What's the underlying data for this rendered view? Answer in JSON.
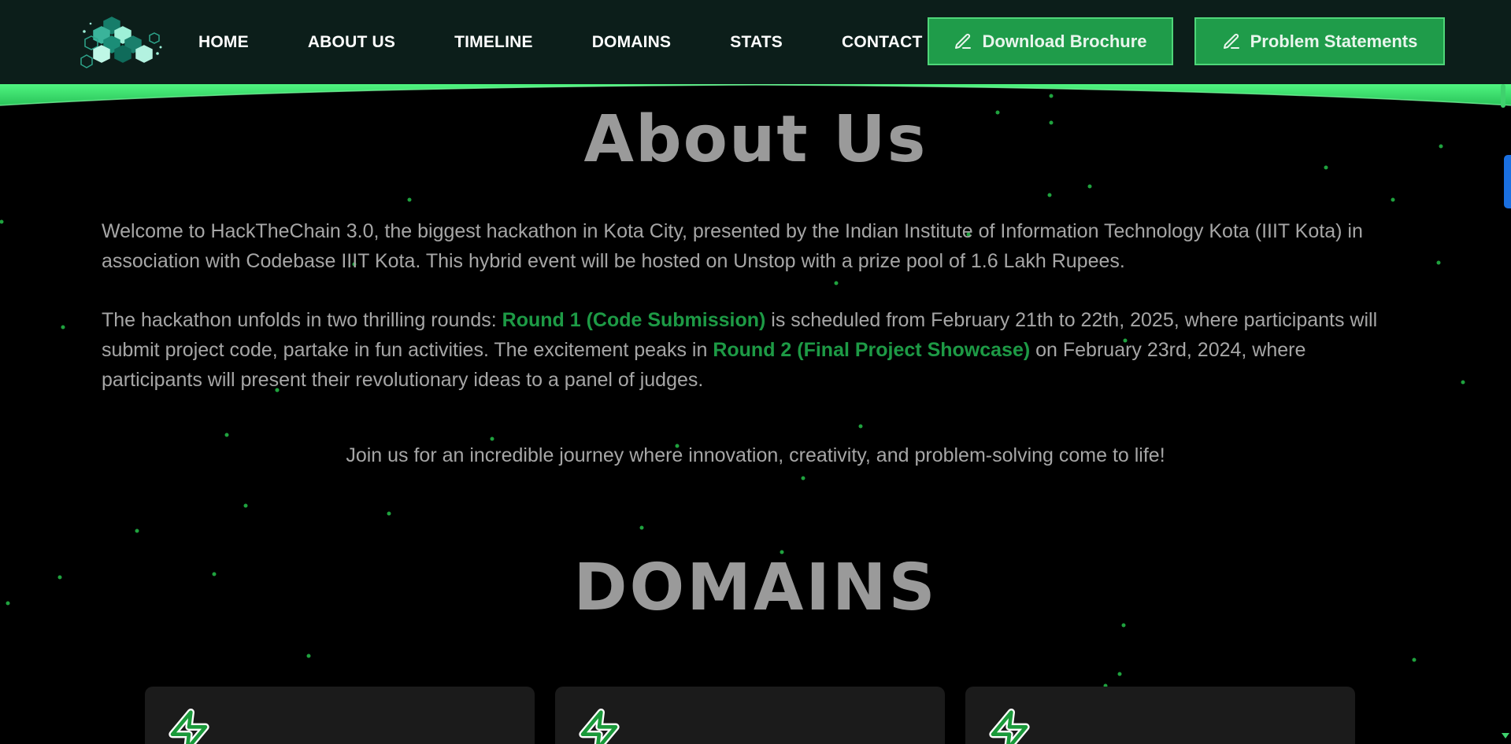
{
  "navbar": {
    "links": [
      "HOME",
      "ABOUT US",
      "TIMELINE",
      "DOMAINS",
      "STATS",
      "CONTACT"
    ],
    "brochure_label": "Download Brochure",
    "problems_label": "Problem Statements"
  },
  "about": {
    "title": "About Us",
    "para1": "Welcome to HackTheChain 3.0, the biggest hackathon in Kota City, presented by the Indian Institute of Information Technology Kota (IIIT Kota) in association with Codebase IIIT Kota. This hybrid event will be hosted on Unstop with a prize pool of 1.6 Lakh Rupees.",
    "para2_a": "The hackathon unfolds in two thrilling rounds: ",
    "round1": "Round 1 (Code Submission)",
    "para2_b": " is scheduled from February 21th to 22th, 2025, where participants will submit project code, partake in fun activities. The excitement peaks in ",
    "round2": "Round 2 (Final Project Showcase)",
    "para2_c": " on February 23rd, 2024, where participants will present their revolutionary ideas to a panel of judges.",
    "para3": "Join us for an incredible journey where innovation, creativity, and problem-solving come to life!"
  },
  "domains": {
    "title": "DOMAINS",
    "card_icon": "lightning-icon"
  },
  "colors": {
    "nav_bg": "#0c1e1a",
    "accent_green": "#1f9c4a",
    "glow_green": "#4ff580",
    "highlight_green": "#1d9a45",
    "text_gray": "#a6a6a6",
    "title_gray": "#9a9a9a"
  },
  "icons": {
    "logo": "hexagon-cluster-logo",
    "button_icon": "pencil-icon"
  }
}
